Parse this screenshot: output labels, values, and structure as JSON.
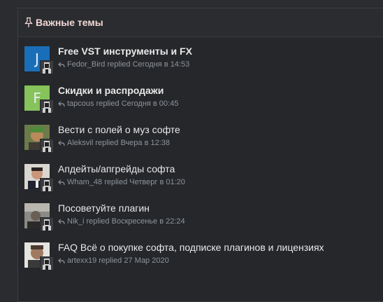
{
  "panel": {
    "title": "Важные темы",
    "icon": "pin-icon",
    "title_color": "#f3d7d5"
  },
  "topics": [
    {
      "title": "Free VST инструменты и FX",
      "bold": true,
      "avatar_type": "letter",
      "avatar_letter": "J",
      "avatar_color": "#1a6eb8",
      "user": "Fedor_Bird",
      "action": "replied",
      "time": "Сегодня в 14:53"
    },
    {
      "title": "Скидки и распродажи",
      "bold": true,
      "avatar_type": "letter",
      "avatar_letter": "F",
      "avatar_color": "#86c35a",
      "user": "tapcous",
      "action": "replied",
      "time": "Сегодня в 00:45"
    },
    {
      "title": "Вести с полей о муз софте",
      "bold": false,
      "avatar_type": "photo",
      "user": "Aleksvil",
      "action": "replied",
      "time": "Вчера в 12:38"
    },
    {
      "title": "Апдейты/апгрейды софта",
      "bold": false,
      "avatar_type": "photo",
      "user": "Wham_48",
      "action": "replied",
      "time": "Четверг в 01:20"
    },
    {
      "title": "Посоветуйте плагин",
      "bold": false,
      "avatar_type": "photo",
      "user": "Nik_i",
      "action": "replied",
      "time": "Воскресенье в 22:24"
    },
    {
      "title": "FAQ Всё о покупке софта, подписке плагинов и лицензиях",
      "bold": false,
      "avatar_type": "photo",
      "user": "artexx19",
      "action": "replied",
      "time": "27 Мар 2020"
    }
  ]
}
